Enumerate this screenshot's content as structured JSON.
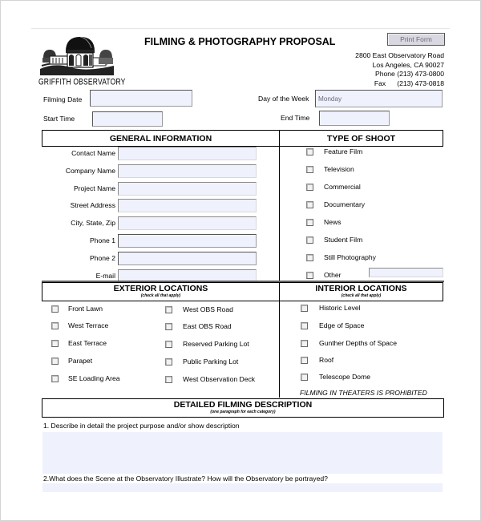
{
  "header": {
    "logo_text": "GRIFFITH OBSERVATORY",
    "title": "FILMING & PHOTOGRAPHY PROPOSAL",
    "print_button": "Print Form",
    "address": {
      "street": "2800 East Observatory Road",
      "city": "Los Angeles, CA  90027",
      "phone": "Phone (213) 473-0800",
      "fax_label": "Fax",
      "fax_number": "(213) 473-0818"
    }
  },
  "schedule": {
    "filming_date": {
      "label": "Filming Date",
      "value": ""
    },
    "day_of_week": {
      "label": "Day of the Week",
      "value": "Monday"
    },
    "start_time": {
      "label": "Start Time",
      "value": ""
    },
    "end_time": {
      "label": "End Time",
      "value": ""
    }
  },
  "general_information": {
    "heading": "GENERAL INFORMATION",
    "fields": [
      {
        "label": "Contact Name",
        "value": ""
      },
      {
        "label": "Company Name",
        "value": ""
      },
      {
        "label": "Project Name",
        "value": ""
      },
      {
        "label": "Street Address",
        "value": ""
      },
      {
        "label": "City, State, Zip",
        "value": ""
      },
      {
        "label": "Phone 1",
        "value": ""
      },
      {
        "label": "Phone 2",
        "value": ""
      },
      {
        "label": "E-mail",
        "value": ""
      }
    ]
  },
  "type_of_shoot": {
    "heading": "TYPE OF SHOOT",
    "options": [
      {
        "label": "Feature Film",
        "checked": false
      },
      {
        "label": "Television",
        "checked": false
      },
      {
        "label": "Commercial",
        "checked": false
      },
      {
        "label": "Documentary",
        "checked": false
      },
      {
        "label": "News",
        "checked": false
      },
      {
        "label": "Student Film",
        "checked": false
      },
      {
        "label": "Still Photography",
        "checked": false
      },
      {
        "label": "Other",
        "checked": false
      }
    ],
    "other_value": ""
  },
  "exterior_locations": {
    "heading": "EXTERIOR LOCATIONS",
    "subheading": "(check all that apply)",
    "left": [
      {
        "label": "Front Lawn",
        "checked": false
      },
      {
        "label": "West Terrace",
        "checked": false
      },
      {
        "label": "East Terrace",
        "checked": false
      },
      {
        "label": "Parapet",
        "checked": false
      },
      {
        "label": "SE Loading Area",
        "checked": false
      }
    ],
    "right": [
      {
        "label": "West OBS Road",
        "checked": false
      },
      {
        "label": "East OBS Road",
        "checked": false
      },
      {
        "label": "Reserved Parking Lot",
        "checked": false
      },
      {
        "label": "Public Parking Lot",
        "checked": false
      },
      {
        "label": "West Observation Deck",
        "checked": false
      }
    ]
  },
  "interior_locations": {
    "heading": "INTERIOR LOCATIONS",
    "subheading": "(check all that apply)",
    "options": [
      {
        "label": "Historic Level",
        "checked": false
      },
      {
        "label": "Edge of Space",
        "checked": false
      },
      {
        "label": "Gunther Depths of Space",
        "checked": false
      },
      {
        "label": "Roof",
        "checked": false
      },
      {
        "label": "Telescope Dome",
        "checked": false
      }
    ],
    "note": "FILMING IN THEATERS IS PROHIBITED"
  },
  "detailed_description": {
    "heading": "DETAILED FILMING DESCRIPTION",
    "subheading": "(one paragraph for each category)",
    "questions": [
      {
        "text": "1. Describe in detail the project purpose and/or show description",
        "value": ""
      },
      {
        "text": "2.What does the Scene at the Observatory Illustrate? How will the Observatory be portrayed?",
        "value": ""
      }
    ]
  }
}
